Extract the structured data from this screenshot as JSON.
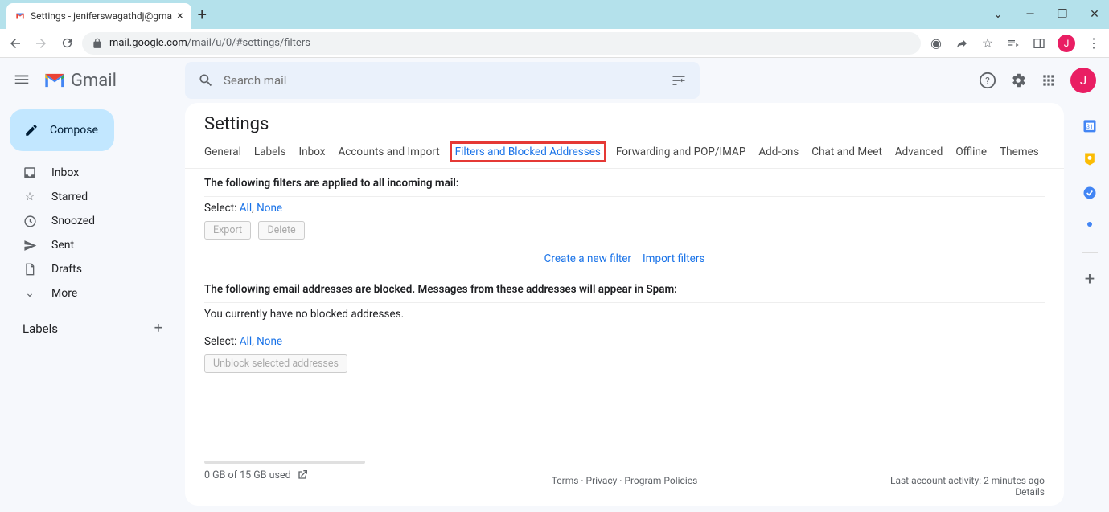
{
  "browser": {
    "tab_title": "Settings - jeniferswagathdj@gma",
    "url_host": "mail.google.com",
    "url_path": "/mail/u/0/#settings/filters"
  },
  "header": {
    "product": "Gmail",
    "search_placeholder": "Search mail",
    "avatar_letter": "J"
  },
  "sidebar": {
    "compose": "Compose",
    "items": [
      {
        "label": "Inbox"
      },
      {
        "label": "Starred"
      },
      {
        "label": "Snoozed"
      },
      {
        "label": "Sent"
      },
      {
        "label": "Drafts"
      },
      {
        "label": "More"
      }
    ],
    "labels_header": "Labels"
  },
  "settings": {
    "title": "Settings",
    "tabs": [
      "General",
      "Labels",
      "Inbox",
      "Accounts and Import",
      "Filters and Blocked Addresses",
      "Forwarding and POP/IMAP",
      "Add-ons",
      "Chat and Meet",
      "Advanced",
      "Offline",
      "Themes"
    ],
    "filters_heading": "The following filters are applied to all incoming mail:",
    "select_label": "Select:",
    "all": "All",
    "none": "None",
    "export_btn": "Export",
    "delete_btn": "Delete",
    "create_filter": "Create a new filter",
    "import_filters": "Import filters",
    "blocked_heading": "The following email addresses are blocked. Messages from these addresses will appear in Spam:",
    "no_blocked": "You currently have no blocked addresses.",
    "unblock_btn": "Unblock selected addresses"
  },
  "footer": {
    "terms": "Terms",
    "privacy": "Privacy",
    "policies": "Program Policies",
    "activity": "Last account activity: 2 minutes ago",
    "details": "Details",
    "storage": "0 GB of 15 GB used"
  }
}
